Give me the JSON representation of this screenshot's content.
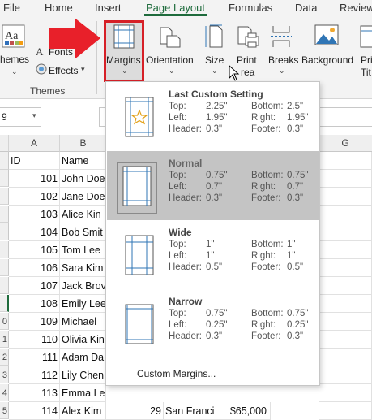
{
  "ribbon": {
    "tabs": [
      {
        "label": "File"
      },
      {
        "label": "Home"
      },
      {
        "label": "Insert"
      },
      {
        "label": "Page Layout"
      },
      {
        "label": "Formulas"
      },
      {
        "label": "Data"
      },
      {
        "label": "Review"
      }
    ],
    "active_tab": "Page Layout",
    "accent_color": "#1e6b3c",
    "themes_group": {
      "themes_label": "hemes",
      "fonts_label": "Fonts",
      "effects_label": "Effects",
      "group_label": "Themes"
    },
    "buttons": {
      "margins": "Margins",
      "orientation": "Orientation",
      "size": "Size",
      "print_area_line1": "Print",
      "print_area_line2": "rea",
      "breaks": "Breaks",
      "background": "Background",
      "print_titles_line1": "Pri",
      "print_titles_line2": "Tit"
    }
  },
  "annotation": {
    "arrow_color": "#e8202a",
    "highlight_color": "#d62027"
  },
  "formula_bar": {
    "name_box": "9"
  },
  "sheet": {
    "columns": [
      "A",
      "B",
      "G"
    ],
    "header_row": {
      "id": "ID",
      "name": "Name"
    },
    "rows": [
      {
        "row": "",
        "id": "101",
        "name": "John Doe"
      },
      {
        "row": "",
        "id": "102",
        "name": "Jane Doe"
      },
      {
        "row": "",
        "id": "103",
        "name": "Alice Kin"
      },
      {
        "row": "",
        "id": "104",
        "name": "Bob Smit"
      },
      {
        "row": "",
        "id": "105",
        "name": "Tom Lee"
      },
      {
        "row": "",
        "id": "106",
        "name": "Sara Kim"
      },
      {
        "row": "",
        "id": "107",
        "name": "Jack Brov"
      },
      {
        "row": "",
        "id": "108",
        "name": "Emily Lee"
      },
      {
        "row": "0",
        "id": "109",
        "name": "Michael"
      },
      {
        "row": "1",
        "id": "110",
        "name": "Olivia Kin"
      },
      {
        "row": "2",
        "id": "111",
        "name": "Adam Da"
      },
      {
        "row": "3",
        "id": "112",
        "name": "Lily Chen"
      },
      {
        "row": "4",
        "id": "113",
        "name": "Emma Le"
      },
      {
        "row": "5",
        "id": "114",
        "name": "Alex Kim"
      }
    ],
    "last_row_extra": {
      "age": "29",
      "city": "San Franci",
      "salary": "$65,000"
    }
  },
  "margins_menu": {
    "labels": {
      "top": "Top:",
      "bottom": "Bottom:",
      "left": "Left:",
      "right": "Right:",
      "header": "Header:",
      "footer": "Footer:"
    },
    "options": [
      {
        "title": "Last Custom Setting",
        "top": "2.25\"",
        "bottom": "2.5\"",
        "left": "1.95\"",
        "right": "1.95\"",
        "header": "0.3\"",
        "footer": "0.3\"",
        "icon": "star-page-icon"
      },
      {
        "title": "Normal",
        "top": "0.75\"",
        "bottom": "0.75\"",
        "left": "0.7\"",
        "right": "0.7\"",
        "header": "0.3\"",
        "footer": "0.3\"",
        "icon": "normal-margins-icon",
        "selected": true
      },
      {
        "title": "Wide",
        "top": "1\"",
        "bottom": "1\"",
        "left": "1\"",
        "right": "1\"",
        "header": "0.5\"",
        "footer": "0.5\"",
        "icon": "wide-margins-icon"
      },
      {
        "title": "Narrow",
        "top": "0.75\"",
        "bottom": "0.75\"",
        "left": "0.25\"",
        "right": "0.25\"",
        "header": "0.3\"",
        "footer": "0.3\"",
        "icon": "narrow-margins-icon"
      }
    ],
    "custom_label": "Custom Margins..."
  }
}
